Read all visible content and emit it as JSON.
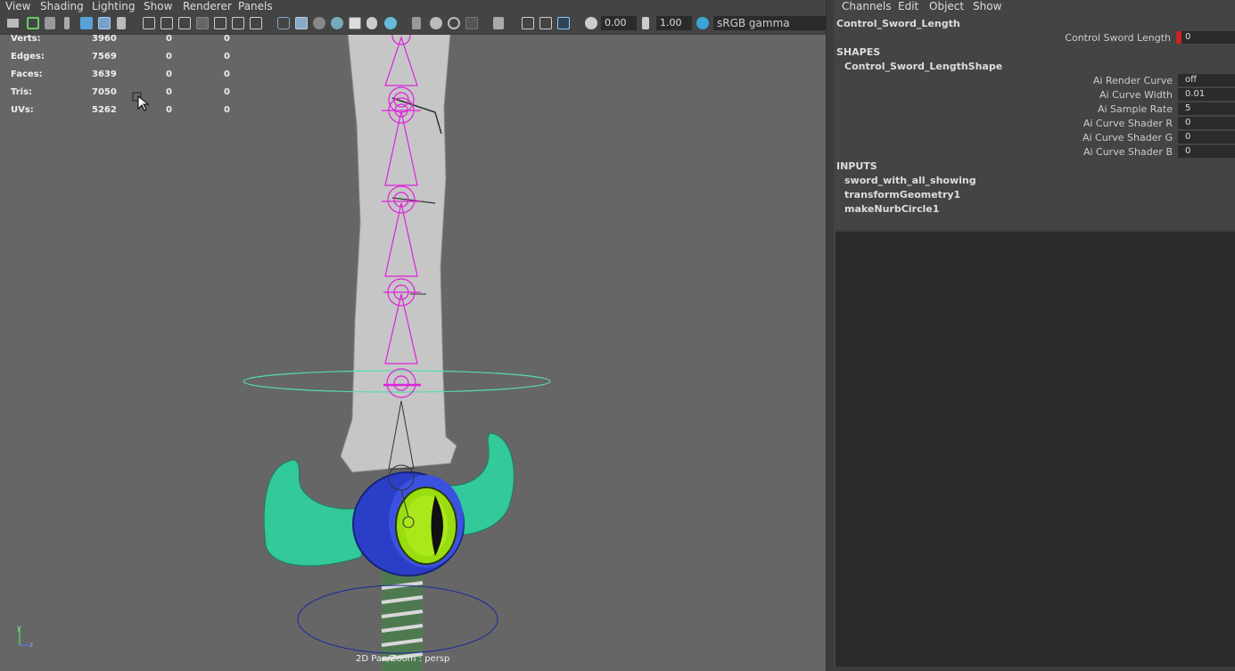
{
  "viewport": {
    "menu": [
      "View",
      "Shading",
      "Lighting",
      "Show",
      "Renderer",
      "Panels"
    ],
    "toolbar": {
      "exposure_value": "0.00",
      "gamma_value": "1.00",
      "colorspace": "sRGB gamma"
    },
    "stats": [
      {
        "label": "Verts:",
        "value": "3960",
        "sel": "0",
        "comp": "0"
      },
      {
        "label": "Edges:",
        "value": "7569",
        "sel": "0",
        "comp": "0"
      },
      {
        "label": "Faces:",
        "value": "3639",
        "sel": "0",
        "comp": "0"
      },
      {
        "label": "Tris:",
        "value": "7050",
        "sel": "0",
        "comp": "0"
      },
      {
        "label": "UVs:",
        "value": "5262",
        "sel": "0",
        "comp": "0"
      }
    ],
    "caption": "2D Pan/Zoom : persp",
    "axis": {
      "y": "y",
      "z": "z"
    },
    "colors": {
      "background": "#666666",
      "joint": "#dd22dd",
      "control_curve": "#55ddaa",
      "blade": "#c8c8c8",
      "guard": "#33c99a",
      "pommel_ring": "#2233aa",
      "eye": "#99dd11"
    }
  },
  "channel_box": {
    "menu": [
      "Channels",
      "Edit",
      "Object",
      "Show"
    ],
    "object_name": "Control_Sword_Length",
    "channel": {
      "label": "Control Sword Length",
      "value": "0",
      "key_color": "#cc2222"
    },
    "shapes_header": "SHAPES",
    "shape_name": "Control_Sword_LengthShape",
    "shape_attrs": [
      {
        "label": "Ai Render Curve",
        "value": "off"
      },
      {
        "label": "Ai Curve Width",
        "value": "0.01"
      },
      {
        "label": "Ai Sample Rate",
        "value": "5"
      },
      {
        "label": "Ai Curve Shader R",
        "value": "0"
      },
      {
        "label": "Ai Curve Shader G",
        "value": "0"
      },
      {
        "label": "Ai Curve Shader B",
        "value": "0"
      }
    ],
    "inputs_header": "INPUTS",
    "inputs": [
      "sword_with_all_showing",
      "transformGeometry1",
      "makeNurbCircle1"
    ]
  }
}
